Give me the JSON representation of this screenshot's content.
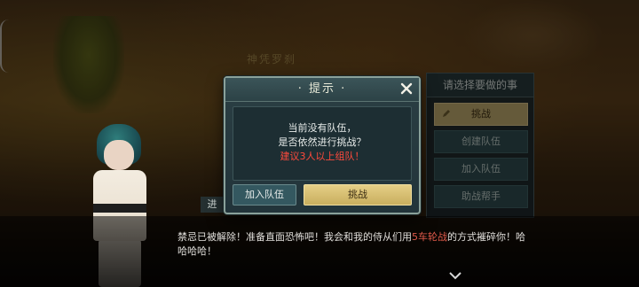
{
  "scene": {
    "boss_name": "神凭罗刹",
    "hidden_tab": "进"
  },
  "side_panel": {
    "title": "请选择要做的事",
    "items": [
      {
        "label": "挑战"
      },
      {
        "label": "创建队伍"
      },
      {
        "label": "加入队伍"
      },
      {
        "label": "助战帮手"
      }
    ]
  },
  "dialogue": {
    "part1": "禁忌已被解除！准备直面恐怖吧！我会和我的侍从们用",
    "highlight": "5车轮战",
    "part2": "的方式摧碎你！哈哈哈哈！"
  },
  "modal": {
    "title": "· 提示 ·",
    "line1": "当前没有队伍，",
    "line2": "是否依然进行挑战？",
    "line3": "建议3人以上组队！",
    "join_label": "加入队伍",
    "fight_label": "挑战"
  },
  "colors": {
    "warning": "#ff4a3c",
    "accent_gold": "#c8ae5e",
    "panel_teal": "#2b3f44"
  },
  "icons": [
    "close-icon",
    "pen-icon",
    "chevron-down-icon"
  ]
}
